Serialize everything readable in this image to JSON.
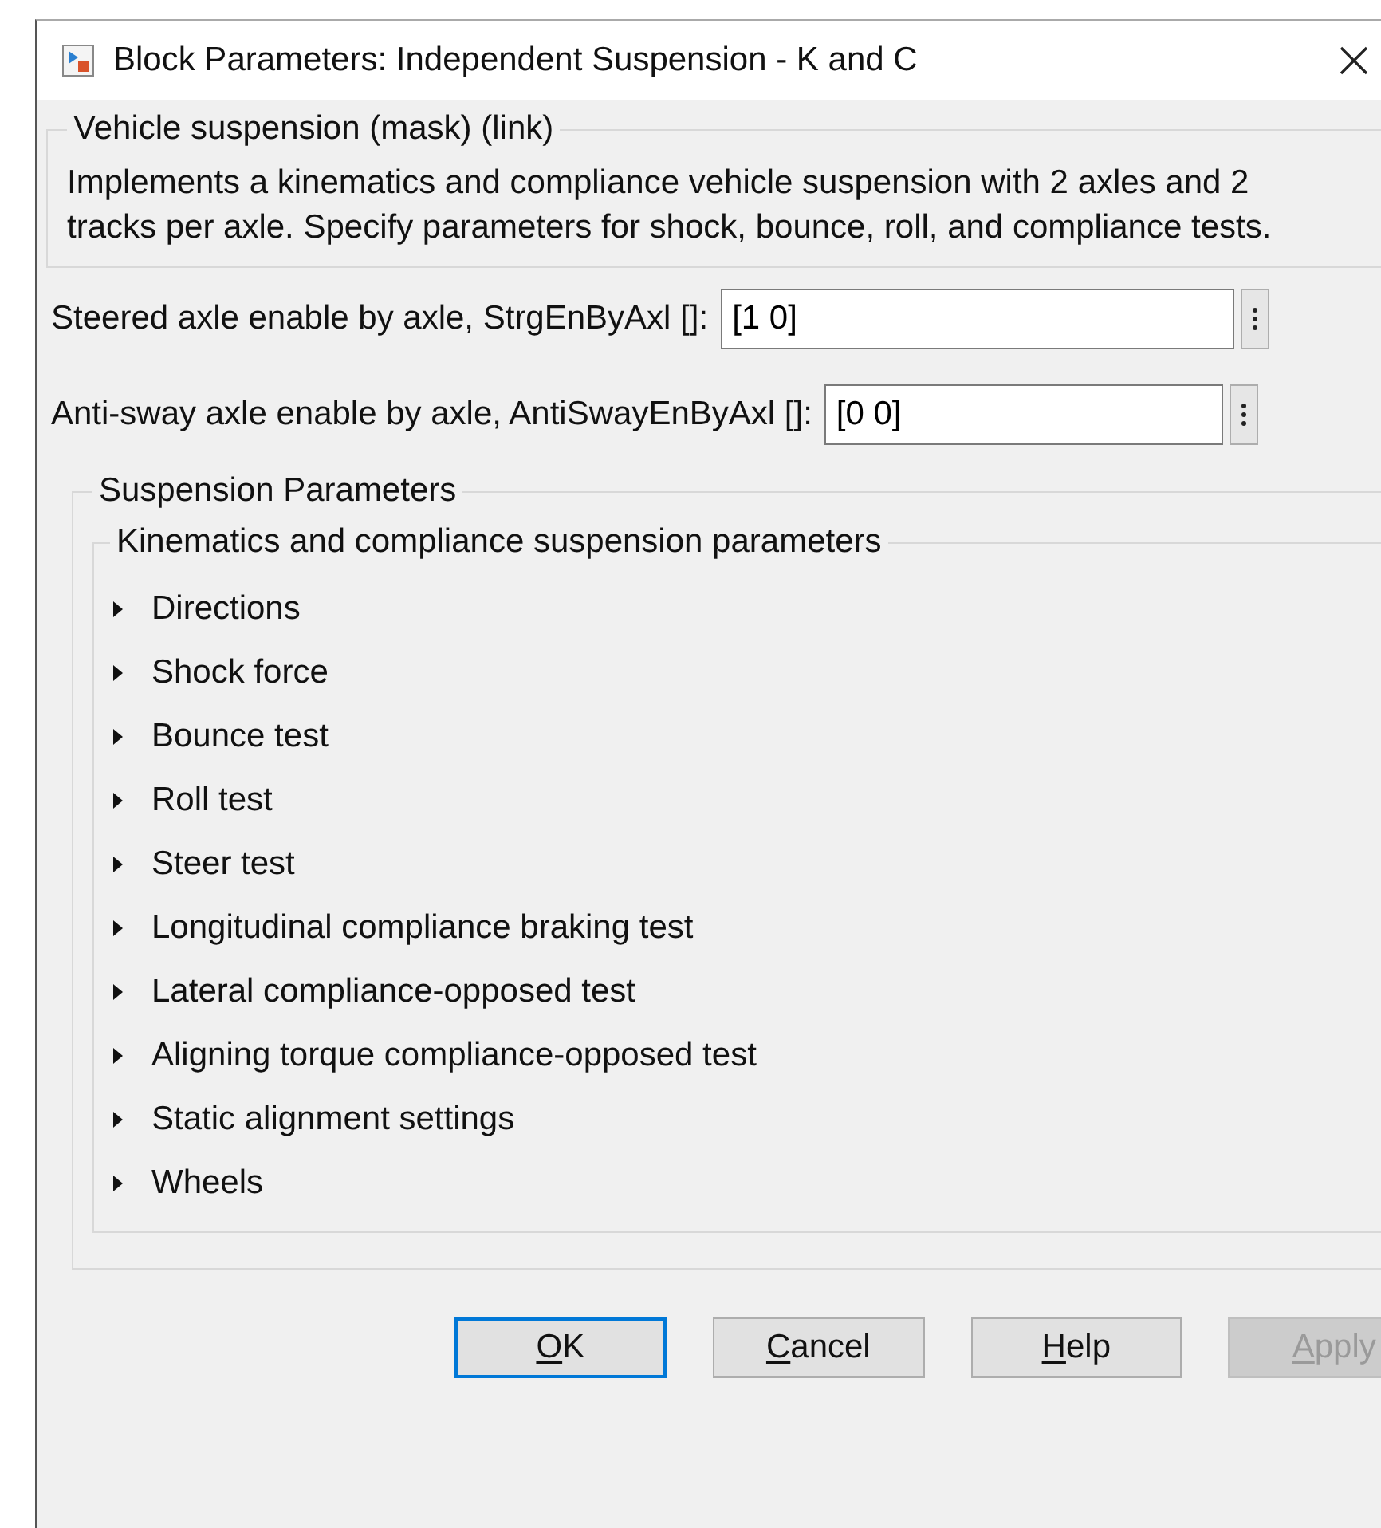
{
  "window": {
    "title": "Block Parameters: Independent Suspension - K and C"
  },
  "description_group": {
    "title": "Vehicle suspension (mask) (link)",
    "text": "Implements a kinematics and compliance vehicle suspension with 2 axles and 2 tracks per axle. Specify parameters for shock, bounce, roll, and compliance tests."
  },
  "parameters": [
    {
      "label": "Steered axle enable by axle, StrgEnByAxl []:",
      "value": "[1 0]"
    },
    {
      "label": "Anti-sway axle enable by axle, AntiSwayEnByAxl []:",
      "value": "[0 0]"
    }
  ],
  "suspension_group": {
    "title": "Suspension Parameters",
    "subgroup": {
      "title": "Kinematics and compliance suspension parameters",
      "sections": [
        {
          "label": "Directions",
          "expanded": false
        },
        {
          "label": "Shock force",
          "expanded": false
        },
        {
          "label": "Bounce test",
          "expanded": false
        },
        {
          "label": "Roll test",
          "expanded": false
        },
        {
          "label": "Steer test",
          "expanded": false
        },
        {
          "label": "Longitudinal compliance braking test",
          "expanded": false
        },
        {
          "label": "Lateral compliance-opposed test",
          "expanded": false
        },
        {
          "label": "Aligning torque compliance-opposed test",
          "expanded": false
        },
        {
          "label": "Static alignment settings",
          "expanded": false
        },
        {
          "label": "Wheels",
          "expanded": false
        }
      ]
    }
  },
  "buttons": [
    {
      "label": "OK",
      "focused": true,
      "disabled": false
    },
    {
      "label": "Cancel",
      "focused": false,
      "disabled": false
    },
    {
      "label": "Help",
      "focused": false,
      "disabled": false
    },
    {
      "label": "Apply",
      "focused": false,
      "disabled": true
    }
  ]
}
